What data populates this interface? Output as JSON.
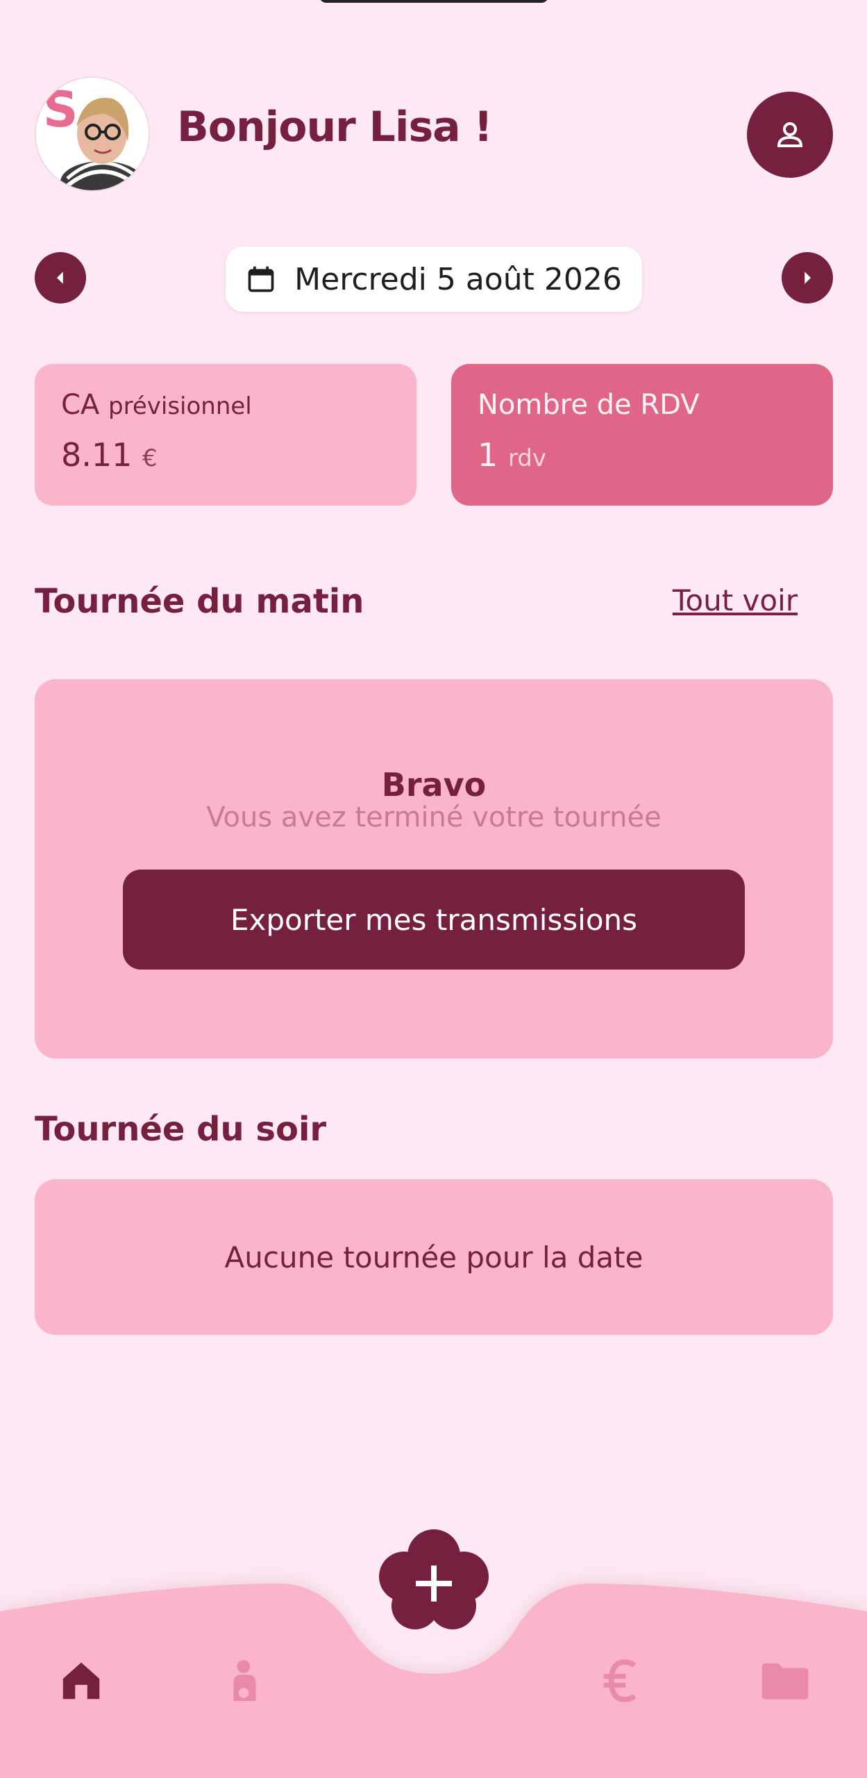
{
  "app": {
    "greeting": "Bonjour Lisa !",
    "date": "Mercredi 5 août 2026"
  },
  "stats": {
    "ca": {
      "title_main": "CA",
      "title_small": "prévisionnel",
      "value": "8.11",
      "unit": "€"
    },
    "rdv": {
      "title": "Nombre de RDV",
      "value": "1",
      "unit": "rdv"
    }
  },
  "morning": {
    "title": "Tournée du matin",
    "see_all": "Tout voir",
    "bravo": "Bravo",
    "subtitle": "Vous avez terminé votre tournée",
    "export_label": "Exporter mes transmissions"
  },
  "evening": {
    "title": "Tournée du soir",
    "empty": "Aucune tournée pour la date"
  },
  "nav": {
    "items": [
      "home-icon",
      "patient-icon",
      "euro-icon",
      "folder-icon"
    ],
    "active": "home"
  },
  "colors": {
    "background": "#fde8f3",
    "primary": "#75203f",
    "card": "#fbb5cb",
    "accent": "#e06689"
  }
}
